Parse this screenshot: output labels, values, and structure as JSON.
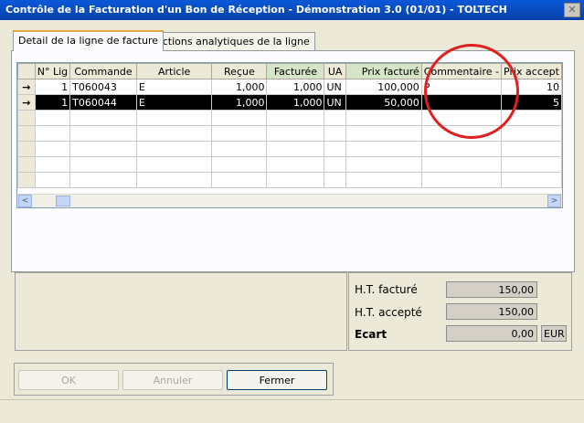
{
  "window": {
    "title": "Contrôle de la Facturation d'un Bon de Réception - Démonstration 3.0 (01/01) - TOLTECH",
    "close_symbol": "✕"
  },
  "tabs": [
    {
      "label": "Detail de la ligne de facture",
      "active": true
    },
    {
      "label": "Sections analytiques de la ligne",
      "active": false
    }
  ],
  "grid": {
    "columns": [
      "N° Lig",
      "Commande",
      "Article",
      "Reçue",
      "Facturée",
      "UA",
      "Prix facturé",
      "Commentaire -",
      "Prix accept"
    ],
    "rows": [
      {
        "indicator": "→",
        "line": "1",
        "order": "T060043",
        "article": "E",
        "received": "1,000",
        "invoiced": "1,000",
        "ua": "UN",
        "price": "100,000",
        "comment": "P",
        "accepted": "10"
      },
      {
        "indicator": "→",
        "line": "1",
        "order": "T060044",
        "article": "E",
        "received": "1,000",
        "invoiced": "1,000",
        "ua": "UN",
        "price": "50,000",
        "comment": "",
        "accepted": "5"
      }
    ]
  },
  "scrollbar": {
    "left_arrow": "<",
    "right_arrow": ">"
  },
  "totals": {
    "ht_facture_label": "H.T. facturé",
    "ht_facture_value": "150,00",
    "ht_accepte_label": "H.T. accepté",
    "ht_accepte_value": "150,00",
    "ecart_label": "Ecart",
    "ecart_value": "0,00",
    "currency": "EUR"
  },
  "buttons": {
    "ok": "OK",
    "annuler": "Annuler",
    "fermer": "Fermer"
  },
  "colors": {
    "title_bar": "#0a58d8",
    "annotation_circle": "#e02020"
  }
}
